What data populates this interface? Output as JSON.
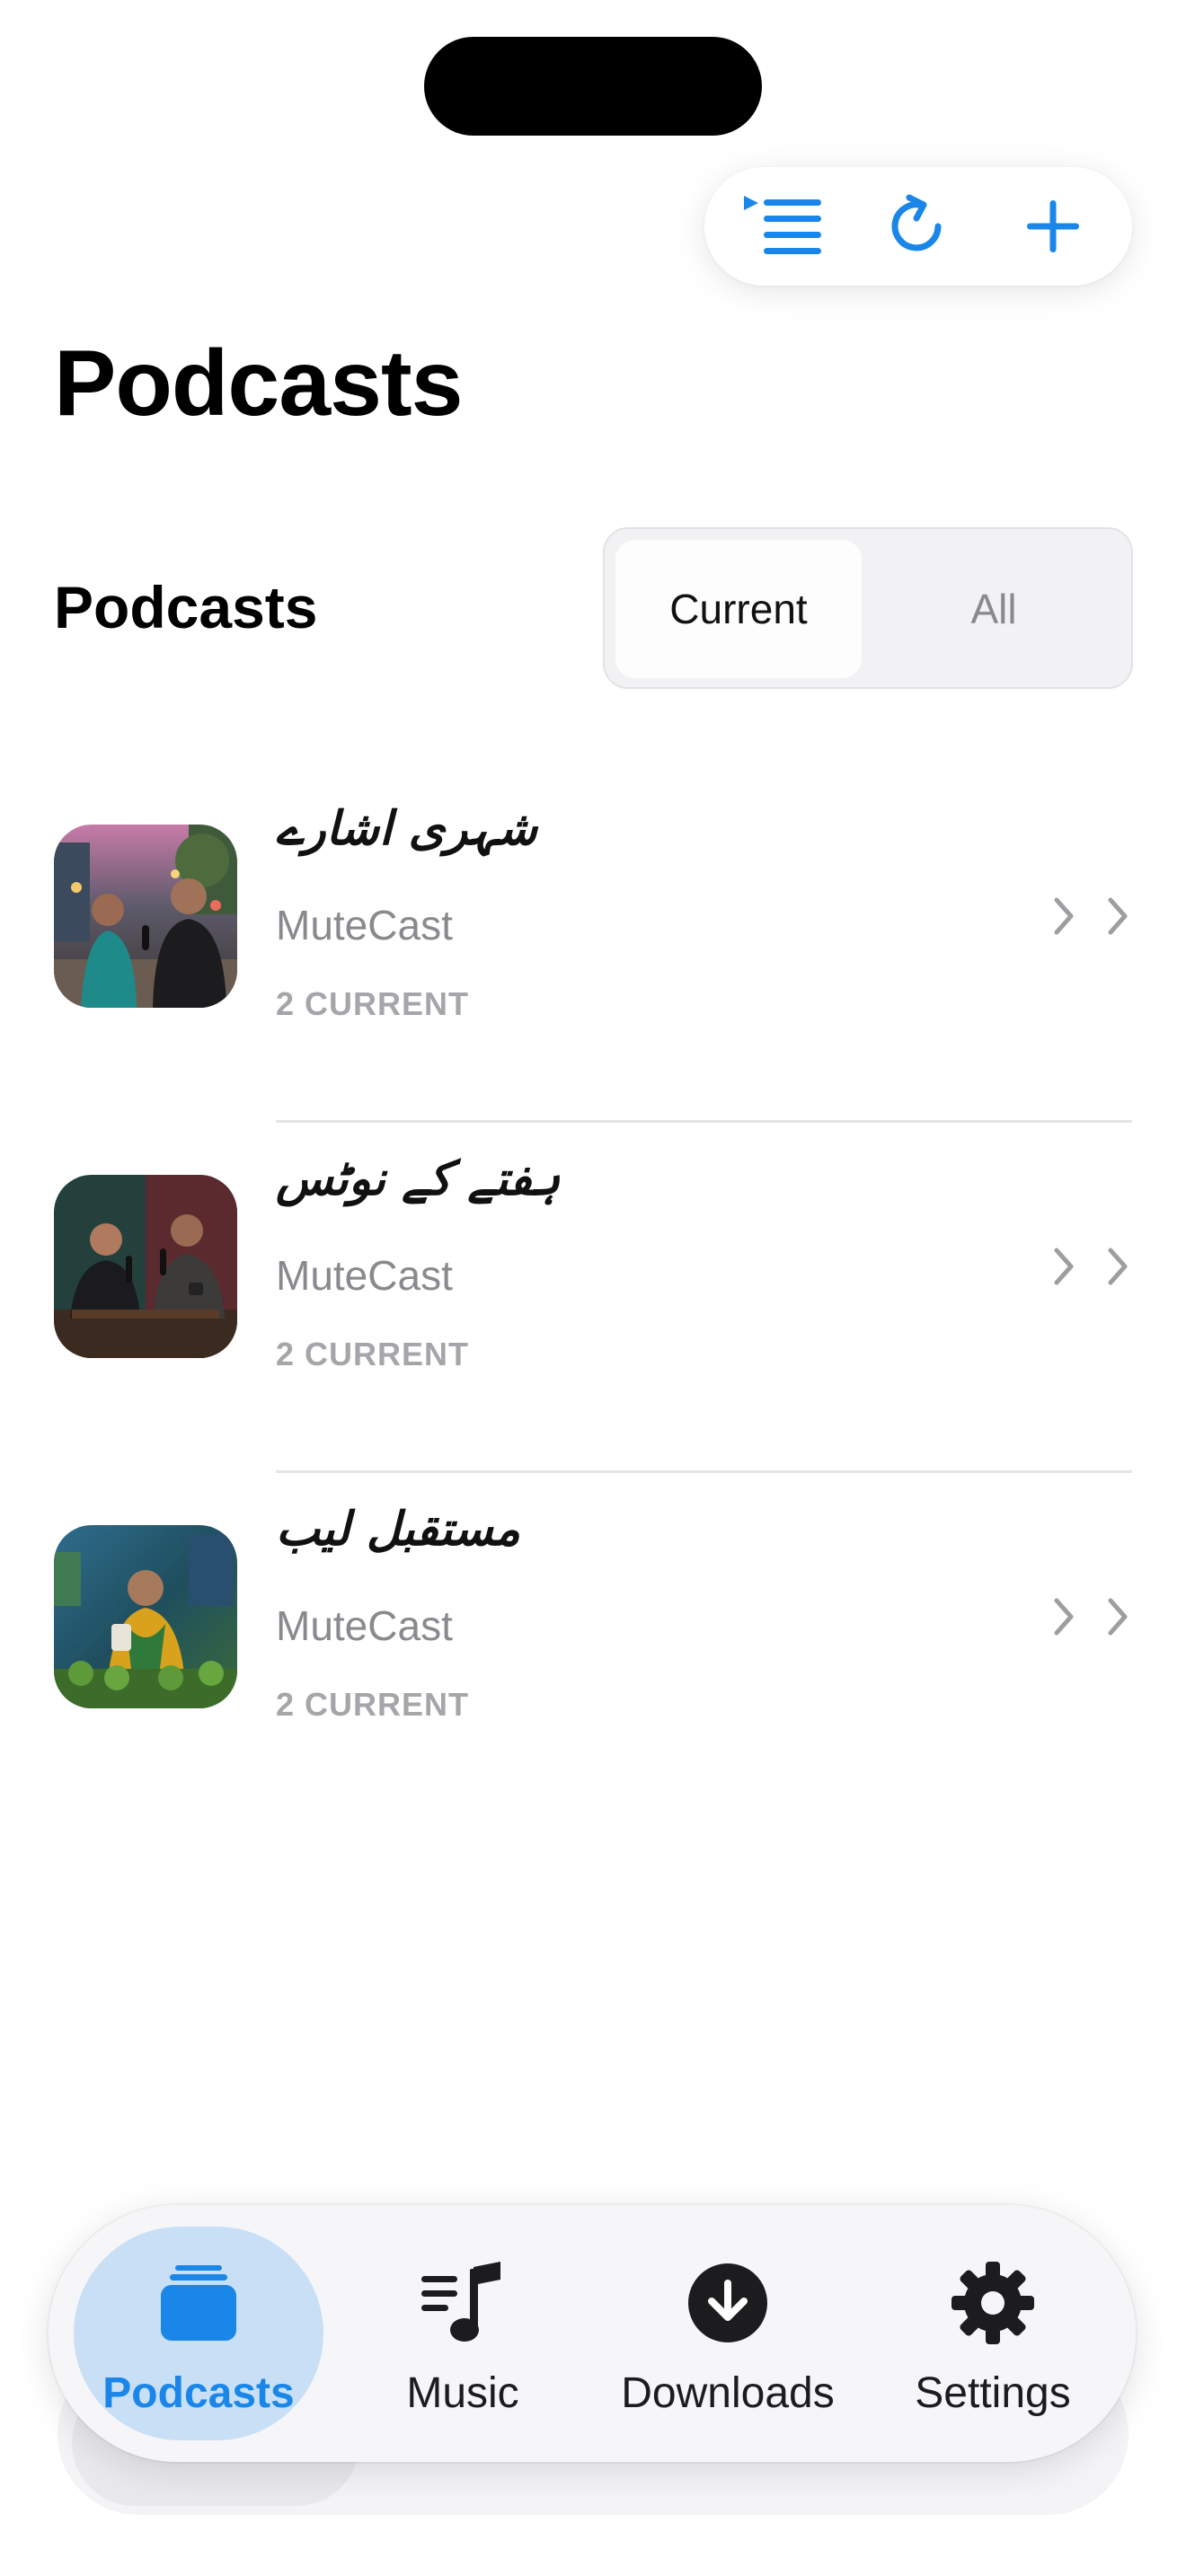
{
  "header": {
    "large_title": "Podcasts",
    "toolbar": {
      "queue_icon": "queue-list-icon",
      "refresh_icon": "refresh-icon",
      "add_icon": "plus-icon"
    }
  },
  "section": {
    "title": "Podcasts",
    "segments": [
      {
        "label": "Current",
        "selected": true
      },
      {
        "label": "All",
        "selected": false
      }
    ]
  },
  "podcasts": [
    {
      "title": "شہری اشارے",
      "author": "MuteCast",
      "count": "2 CURRENT",
      "icon": "chevron-right-icon"
    },
    {
      "title": "ہفتے کے نوٹس",
      "author": "MuteCast",
      "count": "2 CURRENT",
      "icon": "chevron-right-icon"
    },
    {
      "title": "مستقبل لیب",
      "author": "MuteCast",
      "count": "2 CURRENT",
      "icon": "chevron-right-icon"
    }
  ],
  "tabbar": {
    "tabs": [
      {
        "label": "Podcasts",
        "icon": "podcasts-stack-icon",
        "active": true
      },
      {
        "label": "Music",
        "icon": "music-list-icon",
        "active": false
      },
      {
        "label": "Downloads",
        "icon": "download-circle-icon",
        "active": false
      },
      {
        "label": "Settings",
        "icon": "gear-icon",
        "active": false
      }
    ]
  },
  "colors": {
    "accent": "#1a86e8",
    "active_tab_bg": "#c8dff6",
    "secondary_text": "#8a8a8e",
    "divider": "#e5e5e7"
  }
}
